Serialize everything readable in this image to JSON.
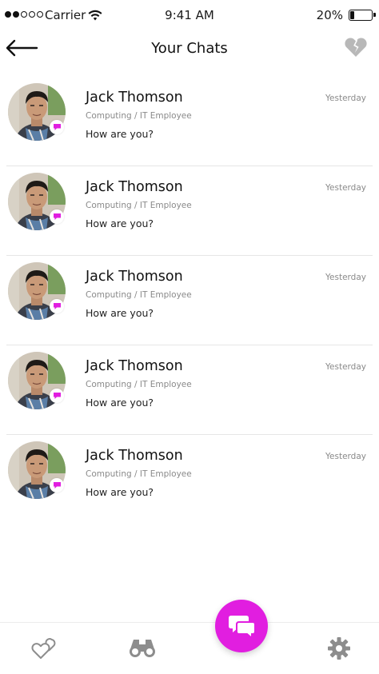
{
  "status_bar": {
    "carrier": "Carrier",
    "time": "9:41 AM",
    "battery": "20%",
    "battery_level": 0.2,
    "signal_bars_filled": 2,
    "signal_bars_total": 5
  },
  "header": {
    "title": "Your Chats",
    "back_icon": "arrow-left-icon",
    "right_icon": "broken-heart-icon"
  },
  "chats": [
    {
      "name": "Jack Thomson",
      "subtitle": "Computing / IT Employee",
      "message": "How are you?",
      "time": "Yesterday"
    },
    {
      "name": "Jack Thomson",
      "subtitle": "Computing / IT Employee",
      "message": "How are you?",
      "time": "Yesterday"
    },
    {
      "name": "Jack Thomson",
      "subtitle": "Computing / IT Employee",
      "message": "How are you?",
      "time": "Yesterday"
    },
    {
      "name": "Jack Thomson",
      "subtitle": "Computing / IT Employee",
      "message": "How are you?",
      "time": "Yesterday"
    },
    {
      "name": "Jack Thomson",
      "subtitle": "Computing / IT Employee",
      "message": "How are you?",
      "time": "Yesterday"
    }
  ],
  "tabbar": {
    "tabs": [
      "hearts-icon",
      "binoculars-icon",
      "chat-bubbles-icon",
      "gear-icon"
    ],
    "active": "chat-bubbles-icon"
  },
  "colors": {
    "accent": "#e11ee0",
    "icon_gray": "#8d8d8d",
    "divider": "#e6e6e6"
  }
}
